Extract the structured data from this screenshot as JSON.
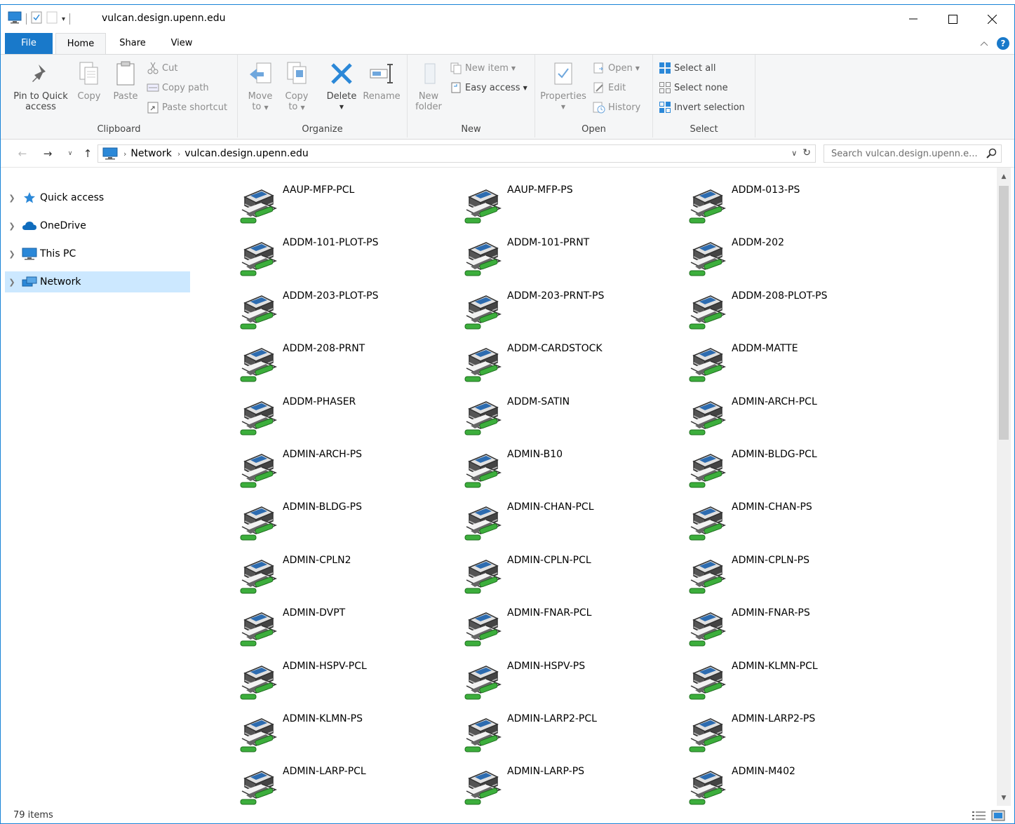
{
  "window": {
    "title": "vulcan.design.upenn.edu",
    "accent_color": "#1979ca"
  },
  "tabs": {
    "file": "File",
    "home": "Home",
    "share": "Share",
    "view": "View"
  },
  "ribbon": {
    "clipboard": {
      "label": "Clipboard",
      "pin_line1": "Pin to Quick",
      "pin_line2": "access",
      "copy": "Copy",
      "paste": "Paste",
      "cut": "Cut",
      "copy_path": "Copy path",
      "paste_shortcut": "Paste shortcut"
    },
    "organize": {
      "label": "Organize",
      "move_line1": "Move",
      "move_line2": "to",
      "copy_line1": "Copy",
      "copy_line2": "to",
      "delete": "Delete",
      "rename": "Rename"
    },
    "new": {
      "label": "New",
      "new_folder_line1": "New",
      "new_folder_line2": "folder",
      "new_item": "New item",
      "easy_access": "Easy access"
    },
    "open": {
      "label": "Open",
      "properties": "Properties",
      "open": "Open",
      "edit": "Edit",
      "history": "History"
    },
    "select": {
      "label": "Select",
      "select_all": "Select all",
      "select_none": "Select none",
      "invert_selection": "Invert selection"
    }
  },
  "address": {
    "crumbs": [
      "Network",
      "vulcan.design.upenn.edu"
    ],
    "search_placeholder": "Search vulcan.design.upenn.e..."
  },
  "nav": {
    "items": [
      {
        "label": "Quick access",
        "icon": "star-icon"
      },
      {
        "label": "OneDrive",
        "icon": "cloud-icon"
      },
      {
        "label": "This PC",
        "icon": "computer-icon"
      },
      {
        "label": "Network",
        "icon": "network-icon",
        "selected": true
      }
    ]
  },
  "printers": [
    "AAUP-MFP-PCL",
    "AAUP-MFP-PS",
    "ADDM-013-PS",
    "ADDM-101-PLOT-PS",
    "ADDM-101-PRNT",
    "ADDM-202",
    "ADDM-203-PLOT-PS",
    "ADDM-203-PRNT-PS",
    "ADDM-208-PLOT-PS",
    "ADDM-208-PRNT",
    "ADDM-CARDSTOCK",
    "ADDM-MATTE",
    "ADDM-PHASER",
    "ADDM-SATIN",
    "ADMIN-ARCH-PCL",
    "ADMIN-ARCH-PS",
    "ADMIN-B10",
    "ADMIN-BLDG-PCL",
    "ADMIN-BLDG-PS",
    "ADMIN-CHAN-PCL",
    "ADMIN-CHAN-PS",
    "ADMIN-CPLN2",
    "ADMIN-CPLN-PCL",
    "ADMIN-CPLN-PS",
    "ADMIN-DVPT",
    "ADMIN-FNAR-PCL",
    "ADMIN-FNAR-PS",
    "ADMIN-HSPV-PCL",
    "ADMIN-HSPV-PS",
    "ADMIN-KLMN-PCL",
    "ADMIN-KLMN-PS",
    "ADMIN-LARP2-PCL",
    "ADMIN-LARP2-PS",
    "ADMIN-LARP-PCL",
    "ADMIN-LARP-PS",
    "ADMIN-M402"
  ],
  "status": {
    "count": "79 items"
  }
}
